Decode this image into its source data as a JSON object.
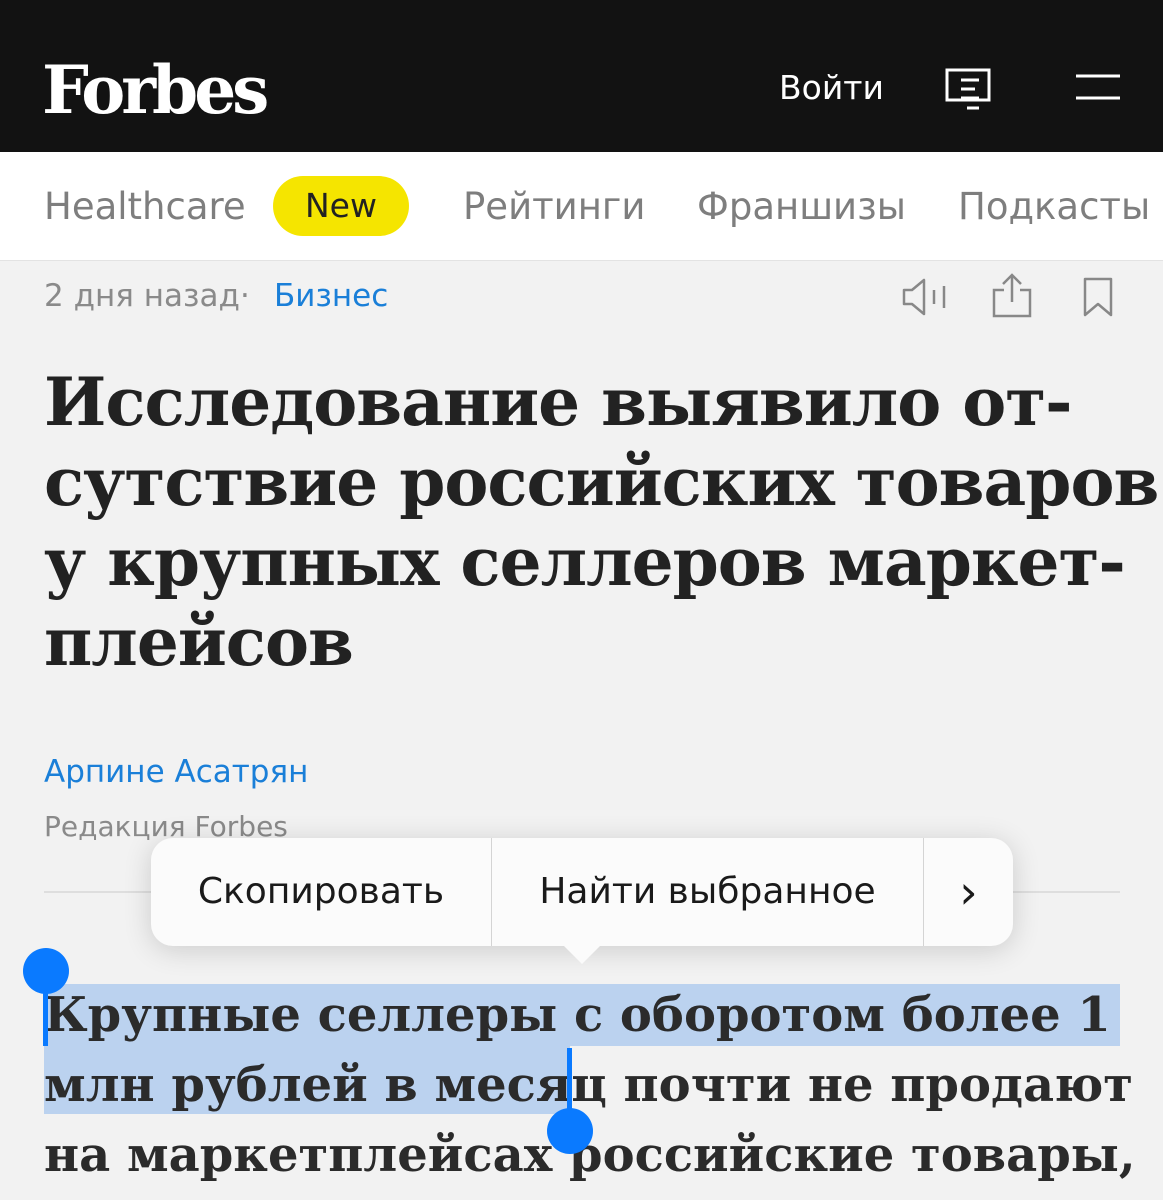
{
  "header": {
    "logo": "Forbes",
    "login_label": "Войти",
    "icons": [
      "magazine-icon",
      "menu-icon"
    ]
  },
  "nav": {
    "items": [
      {
        "label": "Healthcare"
      },
      {
        "label": "New",
        "badge_color": "#f5e500"
      },
      {
        "label": "Рейтинги"
      },
      {
        "label": "Франшизы"
      },
      {
        "label": "Подкасты"
      }
    ]
  },
  "meta": {
    "date": "2 дня назад",
    "separator": "·",
    "category": "Бизнес",
    "icons": [
      "audio-icon",
      "share-icon",
      "bookmark-icon"
    ]
  },
  "article": {
    "headline_lines": [
      "Исследование выявило от-",
      "сутствие российских товаров",
      "у крупных селлеров маркет-",
      "плейсов"
    ],
    "author": "Арпине Асатрян",
    "author_role": "Редакция Forbes",
    "body_lines": [
      "Крупные селлеры с оборотом более 1",
      "млн рублей в месяц почти не продают",
      "на маркетплейсах российские товары,"
    ]
  },
  "context_menu": {
    "copy_label": "Скопировать",
    "find_label": "Найти выбранное",
    "more_label": "›"
  },
  "colors": {
    "header_bg": "#121212",
    "link_blue": "#1a7fd8",
    "selection_blue": "#0a7aff"
  }
}
